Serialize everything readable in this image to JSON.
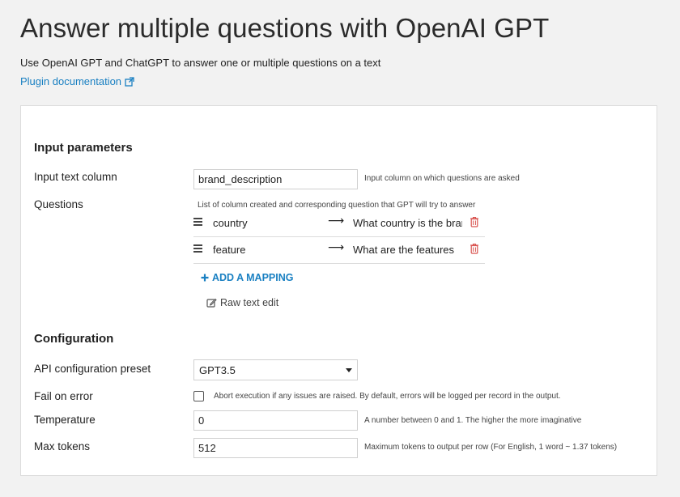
{
  "header": {
    "title": "Answer multiple questions with OpenAI GPT",
    "subtitle": "Use OpenAI GPT and ChatGPT to answer one or multiple questions on a text",
    "doc_link": "Plugin documentation"
  },
  "input_parameters": {
    "section_title": "Input parameters",
    "text_column": {
      "label": "Input text column",
      "value": "brand_description",
      "help": "Input column on which questions are asked"
    },
    "questions": {
      "label": "Questions",
      "help": "List of column created and corresponding question that GPT will try to answer",
      "mappings": [
        {
          "key": "country",
          "value": "What country is the brand"
        },
        {
          "key": "feature",
          "value": "What are the features"
        }
      ],
      "add_label": "ADD A MAPPING",
      "raw_edit_label": "Raw text edit"
    }
  },
  "configuration": {
    "section_title": "Configuration",
    "api_preset": {
      "label": "API configuration preset",
      "value": "GPT3.5"
    },
    "fail_on_error": {
      "label": "Fail on error",
      "checked": false,
      "help": "Abort execution if any issues are raised. By default, errors will be logged per record in the output."
    },
    "temperature": {
      "label": "Temperature",
      "value": "0",
      "help": "A number between 0 and 1. The higher the more imaginative"
    },
    "max_tokens": {
      "label": "Max tokens",
      "value": "512",
      "help": "Maximum tokens to output per row (For English, 1 word ~ 1.37 tokens)"
    }
  },
  "colors": {
    "link": "#1a80c2",
    "delete": "#d9534f",
    "background": "#f2f2f2"
  },
  "icons": {
    "external_link": "external-link-icon",
    "drag": "drag-handle-icon",
    "arrow": "arrow-right-icon",
    "delete": "trash-icon",
    "add": "plus-icon",
    "edit": "edit-icon",
    "dropdown": "caret-down-icon"
  }
}
